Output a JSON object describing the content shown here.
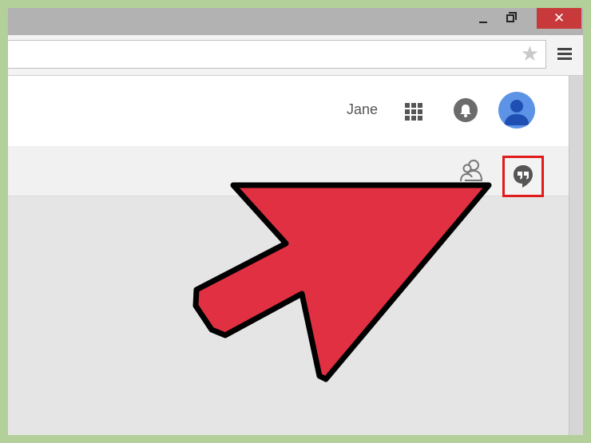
{
  "window": {
    "controls": {
      "minimize_icon": "minimize-icon",
      "maximize_icon": "restore-icon",
      "close_glyph": "✕"
    }
  },
  "toolbar": {
    "star_glyph": "★",
    "menu_icon": "hamburger-menu-icon"
  },
  "header": {
    "user_name": "Jane",
    "icons": [
      "apps-grid-icon",
      "notifications-bell-icon",
      "account-avatar-icon"
    ]
  },
  "subbar": {
    "icons": [
      "people-icon",
      "hangouts-icon"
    ],
    "highlight_color": "#e01c1c"
  },
  "annotation": {
    "arrow_color": "#e03042",
    "points_to": "hangouts-icon"
  },
  "colors": {
    "background": "#b3cf9a",
    "close_button": "#c7393a",
    "avatar": "#5d93e6"
  }
}
